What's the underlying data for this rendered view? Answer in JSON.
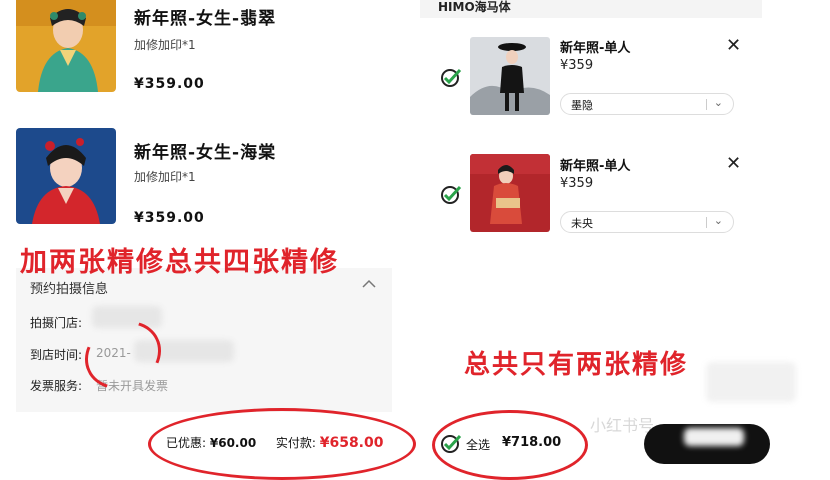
{
  "left_items": [
    {
      "title": "新年照-女生-翡翠",
      "addon": "加修加印*1",
      "price": "¥359.00"
    },
    {
      "title": "新年照-女生-海棠",
      "addon": "加修加印*1",
      "price": "¥359.00"
    }
  ],
  "annotations": {
    "note_left": "加两张精修总共四张精修",
    "note_right": "总共只有两张精修"
  },
  "booking": {
    "title": "预约拍摄信息",
    "store_label": "拍摄门店:",
    "time_label": "到店时间:",
    "time_value": "2021-",
    "invoice_label": "发票服务:",
    "invoice_value": "暂未开具发票"
  },
  "order_footer": {
    "discount_label": "已优惠:",
    "discount_value": "¥60.00",
    "paid_label": "实付款:",
    "paid_value": "¥658.00"
  },
  "cart": {
    "brand": "HIMO海马体",
    "items": [
      {
        "title": "新年照-单人",
        "price": "¥359",
        "option": "墨隐"
      },
      {
        "title": "新年照-单人",
        "price": "¥359",
        "option": "未央"
      }
    ],
    "select_all_label": "全选",
    "total": "¥718.00"
  },
  "watermark": "小红书号",
  "colors": {
    "annotation_red": "#e0242b",
    "checkout_black": "#111111"
  }
}
